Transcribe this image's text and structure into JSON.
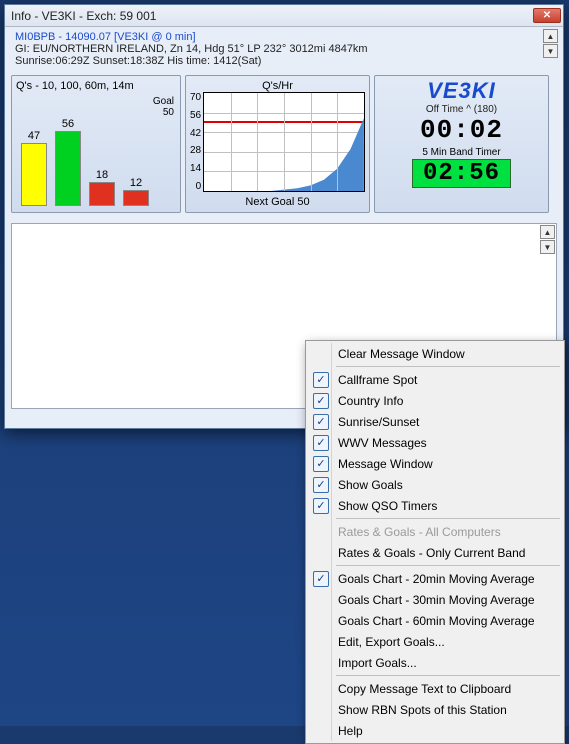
{
  "window": {
    "title": "Info - VE3KI - Exch: 59 001"
  },
  "header": {
    "line1": "MI0BPB - 14090.07 [VE3KI @ 0 min]",
    "line2": "GI: EU/NORTHERN IRELAND, Zn 14, Hdg 51° LP 232° 3012mi 4847km",
    "line3": "Sunrise:06:29Z Sunset:18:38Z His time: 1412(Sat)"
  },
  "barchart": {
    "title": "Q's - 10, 100, 60m, 14m",
    "goal_label": "Goal",
    "goal_value": "50",
    "footer": ""
  },
  "chart_data": [
    {
      "type": "bar",
      "title": "Q's - 10, 100, 60m, 14m",
      "categories": [
        "10",
        "100",
        "60m",
        "14m"
      ],
      "values": [
        47,
        56,
        18,
        12
      ],
      "colors": [
        "#ffff00",
        "#00d020",
        "#e03020",
        "#e03020"
      ],
      "goal": 50,
      "ylim": [
        0,
        60
      ]
    },
    {
      "type": "area",
      "title": "Q's/Hr",
      "ylabel": "",
      "yticks": [
        0,
        14,
        28,
        42,
        56,
        70
      ],
      "ylim": [
        0,
        70
      ],
      "reference_line": 50,
      "next_goal_label": "Next Goal 50",
      "series": [
        {
          "name": "rate",
          "values": [
            0,
            0,
            0,
            0,
            0,
            0,
            1,
            2,
            4,
            8,
            16,
            30,
            52
          ]
        }
      ]
    }
  ],
  "linechart": {
    "title": "Q's/Hr",
    "footer": "Next Goal 50",
    "yticks": [
      "70",
      "56",
      "42",
      "28",
      "14",
      "0"
    ]
  },
  "timer": {
    "call": "VE3KI",
    "off_label": "Off Time ^ (180)",
    "off_value": "00:02",
    "band_label": "5 Min Band Timer",
    "band_value": "02:56"
  },
  "menu": {
    "items": [
      {
        "label": "Clear Message Window",
        "checked": false,
        "group": 0
      },
      {
        "label": "Callframe Spot",
        "checked": true,
        "group": 1
      },
      {
        "label": "Country Info",
        "checked": true,
        "group": 1
      },
      {
        "label": "Sunrise/Sunset",
        "checked": true,
        "group": 1
      },
      {
        "label": "WWV Messages",
        "checked": true,
        "group": 1
      },
      {
        "label": "Message Window",
        "checked": true,
        "group": 1
      },
      {
        "label": "Show Goals",
        "checked": true,
        "group": 1
      },
      {
        "label": "Show QSO Timers",
        "checked": true,
        "group": 1
      },
      {
        "label": "Rates & Goals - All Computers",
        "checked": false,
        "disabled": true,
        "group": 2
      },
      {
        "label": "Rates & Goals - Only Current Band",
        "checked": false,
        "group": 2
      },
      {
        "label": "Goals Chart - 20min Moving Average",
        "checked": true,
        "group": 3
      },
      {
        "label": "Goals Chart - 30min Moving Average",
        "checked": false,
        "group": 3
      },
      {
        "label": "Goals Chart - 60min Moving Average",
        "checked": false,
        "group": 3
      },
      {
        "label": "Edit, Export Goals...",
        "checked": false,
        "group": 3
      },
      {
        "label": "Import Goals...",
        "checked": false,
        "group": 3
      },
      {
        "label": "Copy Message Text to Clipboard",
        "checked": false,
        "group": 4
      },
      {
        "label": "Show RBN Spots of this Station",
        "checked": false,
        "group": 4
      },
      {
        "label": "Help",
        "checked": false,
        "group": 4
      }
    ]
  }
}
